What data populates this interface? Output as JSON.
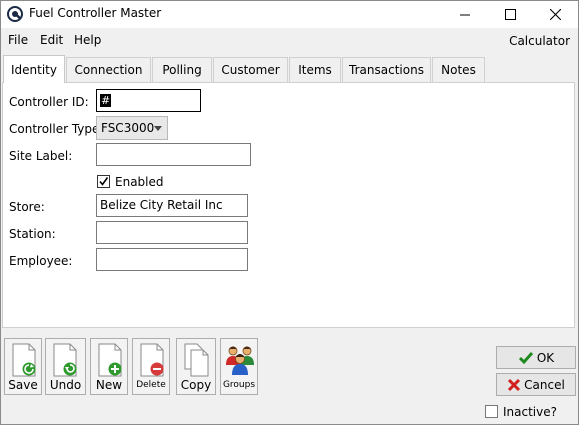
{
  "window": {
    "title": "Fuel Controller Master",
    "icons": {
      "app": "app-logo-icon",
      "minimize": "minimize-icon",
      "maximize": "maximize-icon",
      "close": "close-icon"
    }
  },
  "menu": {
    "file": "File",
    "edit": "Edit",
    "help": "Help",
    "calculator": "Calculator"
  },
  "tabs": [
    {
      "label": "Identity",
      "active": true
    },
    {
      "label": "Connection",
      "active": false
    },
    {
      "label": "Polling",
      "active": false
    },
    {
      "label": "Customer",
      "active": false
    },
    {
      "label": "Items",
      "active": false
    },
    {
      "label": "Transactions",
      "active": false
    },
    {
      "label": "Notes",
      "active": false
    }
  ],
  "form": {
    "controller_id_label": "Controller ID:",
    "controller_id_value": "#",
    "controller_type_label": "Controller Type:",
    "controller_type_value": "FSC3000",
    "site_label_label": "Site Label:",
    "site_label_value": "",
    "enabled_label": "Enabled",
    "enabled_checked": true,
    "store_label": "Store:",
    "store_value": "Belize City Retail Inc",
    "station_label": "Station:",
    "station_value": "",
    "employee_label": "Employee:",
    "employee_value": ""
  },
  "toolbar": {
    "save": "Save",
    "undo": "Undo",
    "new": "New",
    "delete": "Delete",
    "copy": "Copy",
    "groups": "Groups"
  },
  "dialog": {
    "ok": "OK",
    "cancel": "Cancel",
    "inactive_label": "Inactive?",
    "inactive_checked": false
  },
  "colors": {
    "ok_check": "#1e8a1e",
    "cancel_x": "#d02020",
    "add_green": "#2e9a2e",
    "delete_red": "#d63a3a"
  }
}
